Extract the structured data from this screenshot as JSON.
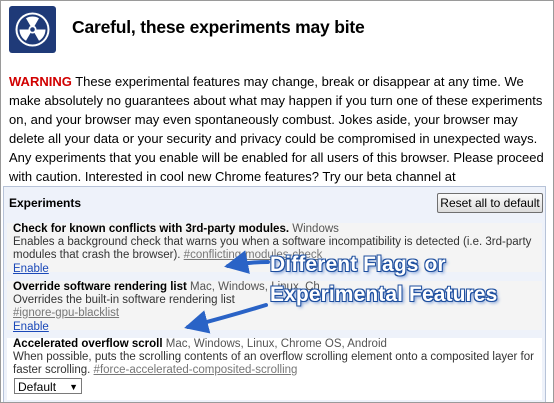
{
  "header": {
    "logo_icon": "radiation-icon",
    "title": "Careful, these experiments may bite"
  },
  "warning": {
    "label": "WARNING",
    "text": " These experimental features may change, break or disappear at any time. We make absolutely no guarantees about what may happen if you turn one of these experiments on, and your browser may even spontaneously combust. Jokes aside, your browser may delete all your data or your security and privacy could be compromised in unexpected ways. Any experiments that you enable will be enabled for all users of this browser. Please proceed with caution. Interested in cool new Chrome features? Try our beta channel at chrome.com/beta."
  },
  "experiments": {
    "header": "Experiments",
    "reset_label": "Reset all to default",
    "items": [
      {
        "name": "Check for known conflicts with 3rd-party modules.",
        "platforms": " Windows",
        "description": "Enables a background check that warns you when a software incompatibility is detected (i.e. 3rd-party modules that crash the browser).",
        "flag": "#conflicting-modules-check",
        "action": "Enable"
      },
      {
        "name": "Override software rendering list",
        "platforms": " Mac, Windows, Linux, Ch",
        "description": "Overrides the built-in software rendering list",
        "flag": "#ignore-gpu-blacklist",
        "action": "Enable"
      },
      {
        "name": "Accelerated overflow scroll",
        "platforms": " Mac, Windows, Linux, Chrome OS, Android",
        "description": "When possible, puts the scrolling contents of an overflow scrolling element onto a composited layer for faster scrolling.",
        "flag": "#force-accelerated-composited-scrolling",
        "select_value": "Default"
      }
    ]
  },
  "annotations": {
    "line1": "Different Flags or",
    "line2": "Experimental Features",
    "color": "#2a63c6"
  }
}
